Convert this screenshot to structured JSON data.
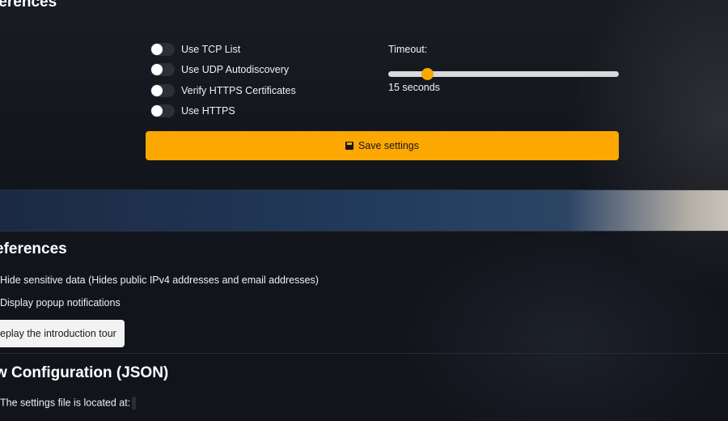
{
  "sections": {
    "top_title": "ferences",
    "preferences_title": "eferences",
    "raw_config_title": "w Configuration (JSON)"
  },
  "network": {
    "toggles": [
      {
        "label": "Use TCP List",
        "on": false
      },
      {
        "label": "Use UDP Autodiscovery",
        "on": false
      },
      {
        "label": "Verify HTTPS Certificates",
        "on": false
      },
      {
        "label": "Use HTTPS",
        "on": false
      }
    ],
    "timeout_label": "Timeout:",
    "timeout_value": "15 seconds",
    "timeout_seconds": 15,
    "save_label": "Save settings"
  },
  "preferences": {
    "hide_sensitive": "Hide sensitive data (Hides public IPv4 addresses and email addresses)",
    "popup_notifications": "Display popup notifications",
    "replay_tour": "eplay the introduction tour"
  },
  "raw_config": {
    "location_text": "The settings file is located at:"
  },
  "colors": {
    "accent": "#fda702",
    "background": "#13151d",
    "toggle_off": "#2c2f37"
  }
}
